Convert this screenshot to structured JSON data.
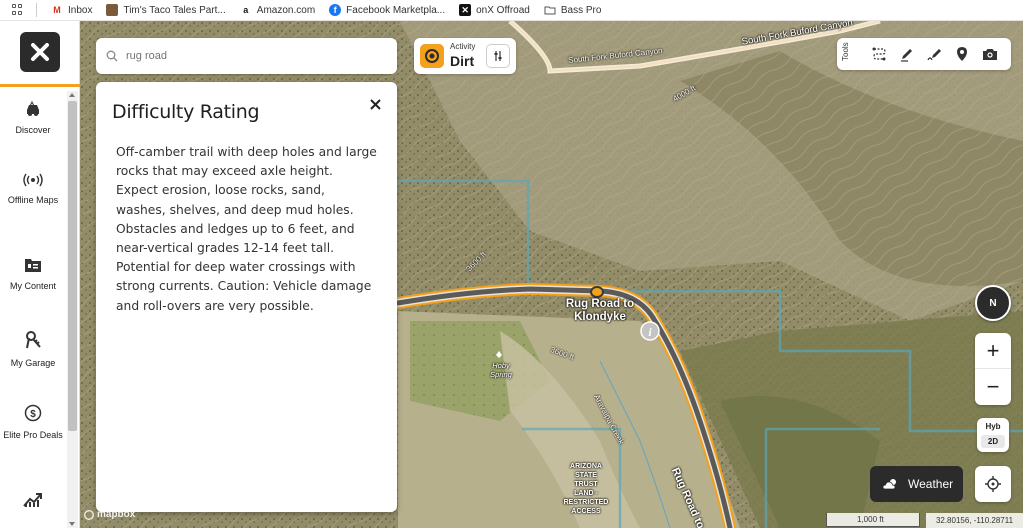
{
  "bookmarks": {
    "items": [
      {
        "label": "Inbox",
        "icon": "gmail-icon"
      },
      {
        "label": "Tim's Taco Tales Part...",
        "icon": "image-icon"
      },
      {
        "label": "Amazon.com",
        "icon": "amazon-icon"
      },
      {
        "label": "Facebook Marketpla...",
        "icon": "facebook-icon"
      },
      {
        "label": "onX Offroad",
        "icon": "onx-icon"
      },
      {
        "label": "Bass Pro",
        "icon": "folder-icon"
      }
    ]
  },
  "sidebar": {
    "items": [
      {
        "label": "Discover",
        "icon": "discover-icon"
      },
      {
        "label": "Offline Maps",
        "icon": "offline-maps-icon"
      },
      {
        "label": "My Content",
        "icon": "my-content-icon"
      },
      {
        "label": "My Garage",
        "icon": "garage-icon"
      },
      {
        "label": "Elite Pro Deals",
        "icon": "dollar-icon"
      },
      {
        "label": "",
        "icon": "trending-icon"
      }
    ]
  },
  "search": {
    "placeholder": "rug road"
  },
  "activity": {
    "label": "Activity",
    "value": "Dirt"
  },
  "tools": {
    "label": "Tools"
  },
  "panel": {
    "title": "Difficulty Rating",
    "description": "Off-camber trail with deep holes and large rocks that may exceed axle height. Expect erosion, loose rocks, sand, washes, shelves, and deep mud holes. Obstacles and ledges up to 6 feet, and near-vertical grades 12-14 feet tall. Potential for deep water crossings with strong currents. Caution: Vehicle damage and roll-overs are very possible."
  },
  "map": {
    "labels": {
      "south_fork_road": "South Fork Buford Canyon",
      "south_fork_canyon": "South Fork Buford Canyon",
      "contour_4000": "4000 ft",
      "contour_3600a": "3600 ft",
      "contour_3600b": "3600 ft",
      "trail_name": "Rug Road to Klondyke",
      "trail_name_line1": "Rug Road to",
      "trail_name_line2": "Klondyke",
      "road_label": "Rug Road to K",
      "creek": "Aravaipa Creek",
      "spring": "Hoby Spring",
      "trust_land": "ARIZONA STATE TRUST LAND - RESTRICTED ACCESS",
      "trust_lines": [
        "ARIZONA",
        "STATE",
        "TRUST",
        "LAND -",
        "RESTRICTED",
        "ACCESS"
      ]
    },
    "compass": "N",
    "zoom_in": "+",
    "zoom_out": "−",
    "layer_type": "Hyb",
    "layer_mode": "2D",
    "weather_label": "Weather",
    "scale": "1,000 ft",
    "coordinates": "32.80156, -110.28711",
    "attribution": "mapbox"
  },
  "colors": {
    "accent": "#f3a01c",
    "dark": "#2b2b2b",
    "trail": "#5a5a5a"
  }
}
